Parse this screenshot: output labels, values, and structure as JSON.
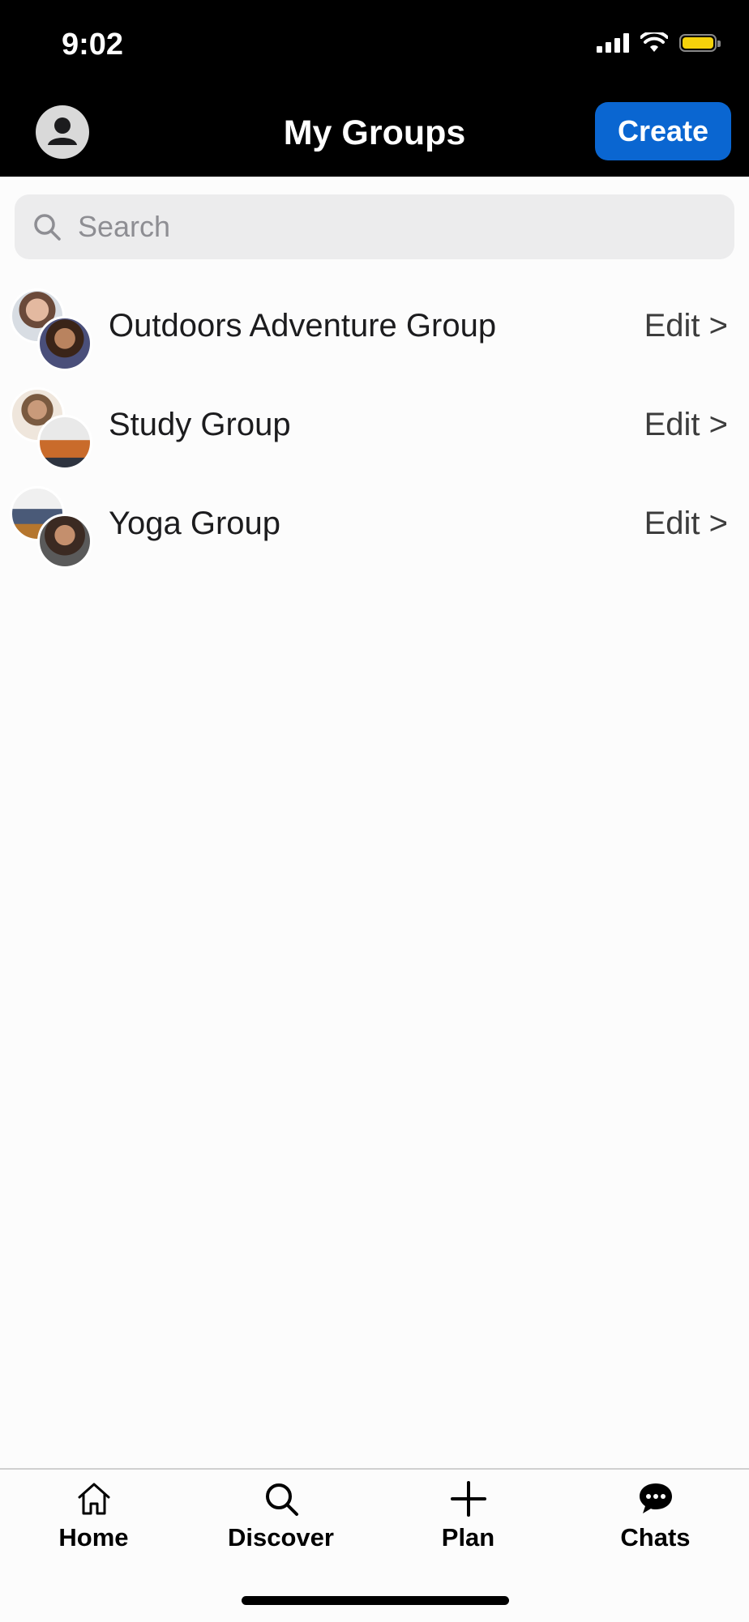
{
  "status_bar": {
    "time": "9:02"
  },
  "header": {
    "title": "My Groups",
    "create_label": "Create"
  },
  "search": {
    "placeholder": "Search"
  },
  "groups": [
    {
      "name": "Outdoors Adventure Group",
      "action": "Edit >"
    },
    {
      "name": "Study Group",
      "action": "Edit >"
    },
    {
      "name": "Yoga Group",
      "action": "Edit >"
    }
  ],
  "tabbar": {
    "home": "Home",
    "discover": "Discover",
    "plan": "Plan",
    "chats": "Chats"
  },
  "colors": {
    "accent": "#0a66d1",
    "header_bg": "#000000",
    "battery": "#f5d20b"
  }
}
